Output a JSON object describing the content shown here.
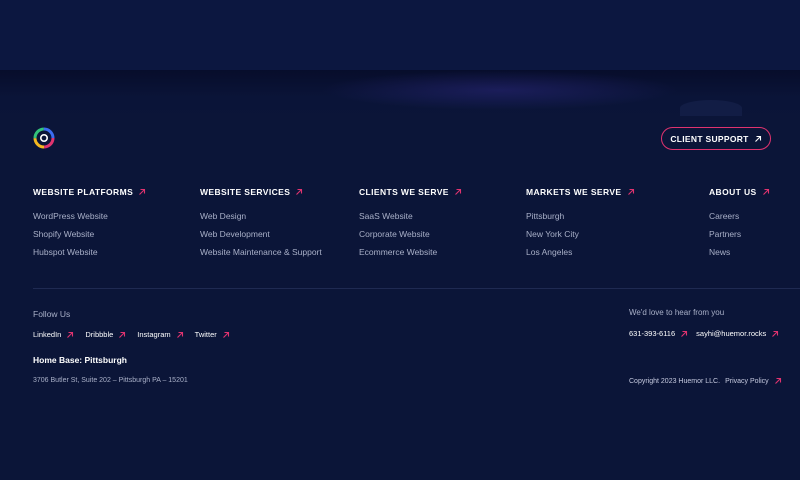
{
  "colors": {
    "background": "#0b1538",
    "accent": "#e0336f",
    "text_primary": "#ffffff",
    "text_muted": "#a9b0c8"
  },
  "header": {
    "logo_icon": "huemor-logo-icon",
    "cta_label": "CLIENT SUPPORT",
    "cta_icon": "arrow-up-right-icon"
  },
  "columns": [
    {
      "title": "WEBSITE PLATFORMS",
      "links": [
        "WordPress Website",
        "Shopify Website",
        "Hubspot Website"
      ]
    },
    {
      "title": "WEBSITE SERVICES",
      "links": [
        "Web Design",
        "Web Development",
        "Website Maintenance & Support"
      ]
    },
    {
      "title": "CLIENTS WE SERVE",
      "links": [
        "SaaS Website",
        "Corporate Website",
        "Ecommerce Website"
      ]
    },
    {
      "title": "MARKETS WE SERVE",
      "links": [
        "Pittsburgh",
        "New York City",
        "Los Angeles"
      ]
    },
    {
      "title": "ABOUT US",
      "links": [
        "Careers",
        "Partners",
        "News"
      ]
    }
  ],
  "follow": {
    "label": "Follow Us",
    "links": [
      "LinkedIn",
      "Dribbble",
      "Instagram",
      "Twitter"
    ]
  },
  "home_base": {
    "title": "Home Base: Pittsburgh",
    "address": "3706 Butler St, Suite 202 – Pittsburgh PA – 15201"
  },
  "contact": {
    "label": "We'd love to hear from you",
    "phone": "631-393-6116",
    "email": "sayhi@huemor.rocks"
  },
  "legal": {
    "copyright": "Copyright 2023 Huemor LLC.",
    "privacy": "Privacy Policy"
  }
}
